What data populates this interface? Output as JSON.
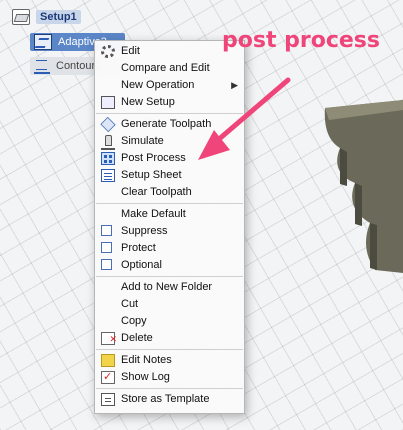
{
  "browser": {
    "setup_label": "Setup1",
    "adaptive_label": "Adaptive3",
    "contour_label": "Contour2"
  },
  "annotation": {
    "text": "post process",
    "color": "#f0457a"
  },
  "context_menu": {
    "groups": [
      [
        {
          "label": "Edit",
          "icon": "gear-icon"
        },
        {
          "label": "Compare and Edit",
          "icon": ""
        },
        {
          "label": "New Operation",
          "icon": "",
          "submenu": true
        },
        {
          "label": "New Setup",
          "icon": "folder-icon"
        }
      ],
      [
        {
          "label": "Generate Toolpath",
          "icon": "generate-toolpath-icon"
        },
        {
          "label": "Simulate",
          "icon": "simulate-icon"
        },
        {
          "label": "Post Process",
          "icon": "post-process-icon"
        },
        {
          "label": "Setup Sheet",
          "icon": "setup-sheet-icon"
        },
        {
          "label": "Clear Toolpath",
          "icon": ""
        }
      ],
      [
        {
          "label": "Make Default",
          "icon": ""
        },
        {
          "label": "Suppress",
          "icon": "checkbox"
        },
        {
          "label": "Protect",
          "icon": "checkbox"
        },
        {
          "label": "Optional",
          "icon": "checkbox"
        }
      ],
      [
        {
          "label": "Add to New Folder",
          "icon": ""
        },
        {
          "label": "Cut",
          "icon": ""
        },
        {
          "label": "Copy",
          "icon": ""
        },
        {
          "label": "Delete",
          "icon": "delete-icon"
        }
      ],
      [
        {
          "label": "Edit Notes",
          "icon": "notes-icon"
        },
        {
          "label": "Show Log",
          "icon": "log-icon"
        }
      ],
      [
        {
          "label": "Store as Template",
          "icon": "template-icon"
        }
      ]
    ]
  }
}
